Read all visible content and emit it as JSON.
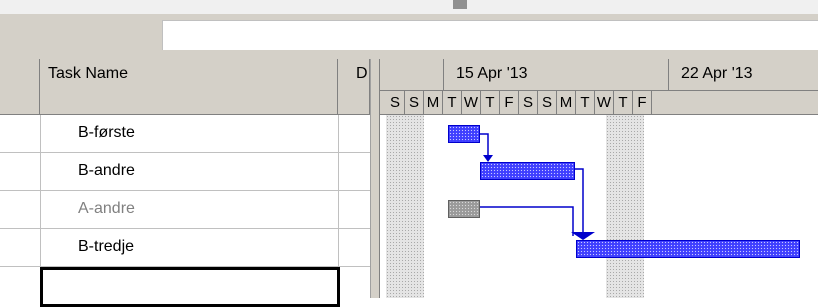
{
  "columns": {
    "task_name": "Task Name",
    "duration_abbrev": "D"
  },
  "tasks": [
    {
      "name": "B-første",
      "status": "active",
      "start_day_index": 0,
      "duration_days": 2
    },
    {
      "name": "B-andre",
      "status": "active",
      "start_day_index": 2,
      "duration_days": 5
    },
    {
      "name": "A-andre",
      "status": "inactive",
      "start_day_index": 0,
      "duration_days": 2
    },
    {
      "name": "B-tredje",
      "status": "active",
      "start_day_index": 7,
      "duration_days": 12
    }
  ],
  "timeline": {
    "weeks": [
      "15 Apr '13",
      "22 Apr '13"
    ],
    "days": [
      "S",
      "S",
      "M",
      "T",
      "W",
      "T",
      "F",
      "S",
      "S",
      "M",
      "T",
      "W",
      "T",
      "F"
    ]
  },
  "colors": {
    "bar_active": "#3f3fff",
    "bar_inactive": "#9a9a9a",
    "link_line": "#0000cc",
    "header_bg": "#d4d0c8"
  }
}
